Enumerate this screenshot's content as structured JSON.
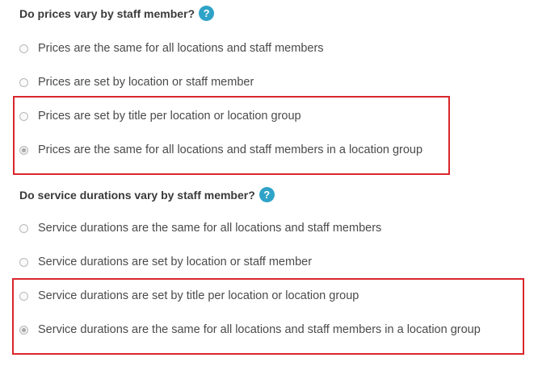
{
  "prices": {
    "question": "Do prices vary by staff member?",
    "help_icon": "question-mark-icon",
    "options": [
      {
        "label": "Prices are the same for all locations and staff members",
        "checked": false
      },
      {
        "label": "Prices are set by location or staff member",
        "checked": false
      },
      {
        "label": "Prices are set by title per location or location group",
        "checked": false
      },
      {
        "label": "Prices are the same for all locations and staff members in a location group",
        "checked": true
      }
    ]
  },
  "durations": {
    "question": "Do service durations vary by staff member?",
    "help_icon": "question-mark-icon",
    "options": [
      {
        "label": "Service durations are the same for all locations and staff members",
        "checked": false
      },
      {
        "label": "Service durations are set by location or staff member",
        "checked": false
      },
      {
        "label": "Service durations are set by title per location or location group",
        "checked": false
      },
      {
        "label": "Service durations are the same for all locations and staff members in a location group",
        "checked": true
      }
    ]
  },
  "colors": {
    "help_icon_bg": "#2ea3c7",
    "highlight_border": "#d9262b"
  }
}
